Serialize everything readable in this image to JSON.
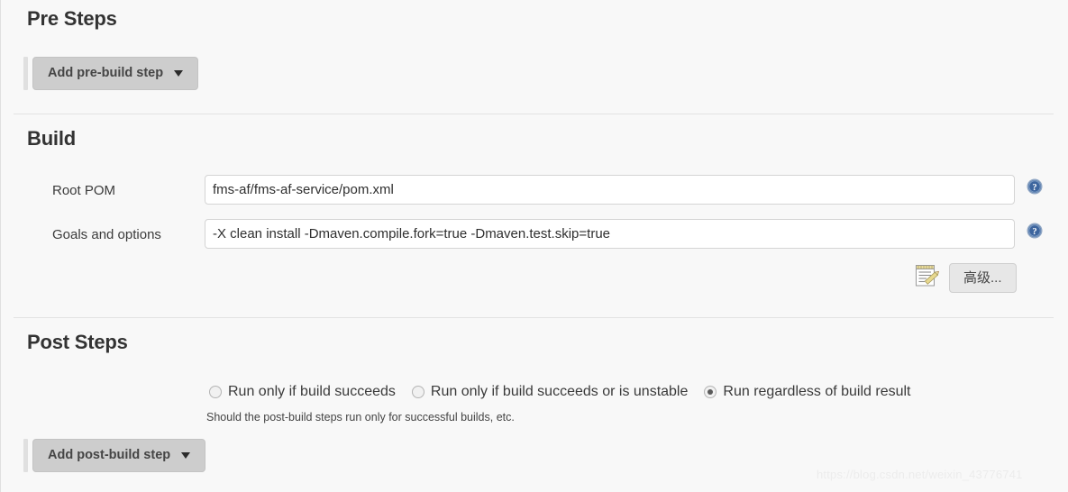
{
  "sections": {
    "pre_steps": {
      "title": "Pre Steps",
      "add_button_label": "Add pre-build step"
    },
    "build": {
      "title": "Build",
      "fields": [
        {
          "label": "Root POM",
          "value": "fms-af/fms-af-service/pom.xml",
          "help_icon": "help-circle-icon"
        },
        {
          "label": "Goals and options",
          "value": "-X clean install -Dmaven.compile.fork=true -Dmaven.test.skip=true",
          "help_icon": "help-circle-icon"
        }
      ],
      "edit_icon": "notepad-pencil-icon",
      "advanced_button_label": "高级..."
    },
    "post_steps": {
      "title": "Post Steps",
      "radios": [
        {
          "label": "Run only if build succeeds",
          "checked": false
        },
        {
          "label": "Run only if build succeeds or is unstable",
          "checked": false
        },
        {
          "label": "Run regardless of build result",
          "checked": true
        }
      ],
      "help_text": "Should the post-build steps run only for successful builds, etc.",
      "add_button_label": "Add post-build step"
    }
  },
  "watermark": "https://blog.csdn.net/weixin_43776741",
  "colors": {
    "page_background": "#f8f8f8",
    "button_background": "#cdcdcd",
    "help_icon_blue": "#4a72a8",
    "divider": "#e3e3e3",
    "input_border": "#d4d4d4"
  }
}
